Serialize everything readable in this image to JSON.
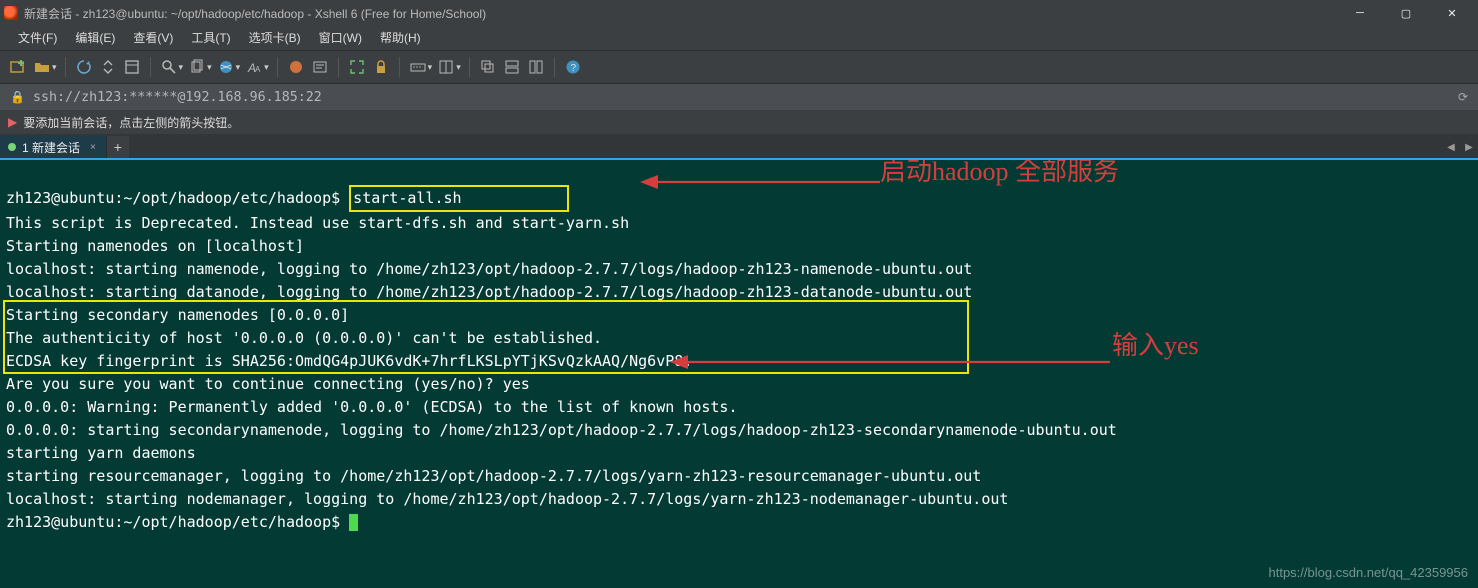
{
  "window": {
    "title": "新建会话 - zh123@ubuntu: ~/opt/hadoop/etc/hadoop - Xshell 6 (Free for Home/School)"
  },
  "menubar": [
    "文件(F)",
    "编辑(E)",
    "查看(V)",
    "工具(T)",
    "选项卡(B)",
    "窗口(W)",
    "帮助(H)"
  ],
  "address": {
    "url": "ssh://zh123:******@192.168.96.185:22"
  },
  "infobar": {
    "text": "要添加当前会话，点击左侧的箭头按钮。"
  },
  "tab": {
    "label": "1 新建会话"
  },
  "terminal": {
    "prompt1": "zh123@ubuntu:~/opt/hadoop/etc/hadoop$ ",
    "cmd1": "start-all.sh",
    "l2": "This script is Deprecated. Instead use start-dfs.sh and start-yarn.sh",
    "l3": "Starting namenodes on [localhost]",
    "l4": "localhost: starting namenode, logging to /home/zh123/opt/hadoop-2.7.7/logs/hadoop-zh123-namenode-ubuntu.out",
    "l5": "localhost: starting datanode, logging to /home/zh123/opt/hadoop-2.7.7/logs/hadoop-zh123-datanode-ubuntu.out",
    "l6": "Starting secondary namenodes [0.0.0.0]",
    "l7": "The authenticity of host '0.0.0.0 (0.0.0.0)' can't be established.",
    "l8": "ECDSA key fingerprint is SHA256:OmdQG4pJUK6vdK+7hrfLKSLpYTjKSvQzkAAQ/Ng6vP8.",
    "l9a": "Are you sure you want to continue connecting (yes/no)? ",
    "l9b": "yes",
    "l10": "0.0.0.0: Warning: Permanently added '0.0.0.0' (ECDSA) to the list of known hosts.",
    "l11": "0.0.0.0: starting secondarynamenode, logging to /home/zh123/opt/hadoop-2.7.7/logs/hadoop-zh123-secondarynamenode-ubuntu.out",
    "l12": "starting yarn daemons",
    "l13": "starting resourcemanager, logging to /home/zh123/opt/hadoop-2.7.7/logs/yarn-zh123-resourcemanager-ubuntu.out",
    "l14": "localhost: starting nodemanager, logging to /home/zh123/opt/hadoop-2.7.7/logs/yarn-zh123-nodemanager-ubuntu.out",
    "prompt2": "zh123@ubuntu:~/opt/hadoop/etc/hadoop$ "
  },
  "annotations": {
    "a1": "启动hadoop 全部服务",
    "a2": "输入yes"
  },
  "watermark": "https://blog.csdn.net/qq_42359956"
}
